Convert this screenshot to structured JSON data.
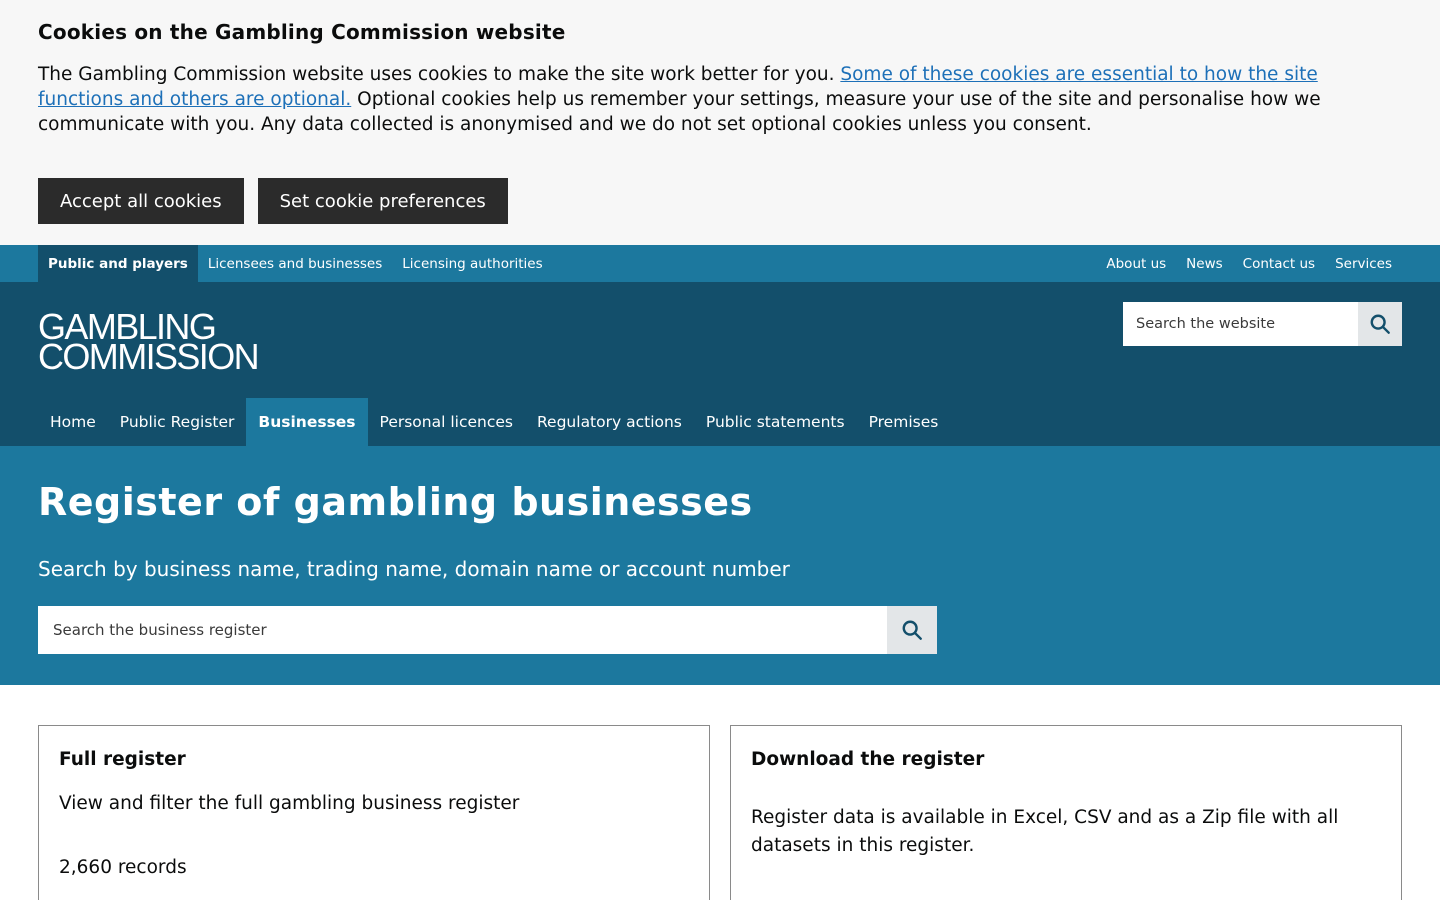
{
  "cookie_banner": {
    "title": "Cookies on the Gambling Commission website",
    "text_before": "The Gambling Commission website uses cookies to make the site work better for you. ",
    "link_text": "Some of these cookies are essential to how the site functions and others are optional.",
    "text_after": " Optional cookies help us remember your settings, measure your use of the site and personalise how we communicate with you. Any data collected is anonymised and we do not set optional cookies unless you consent.",
    "accept_label": "Accept all cookies",
    "preferences_label": "Set cookie preferences"
  },
  "top_nav": {
    "left": [
      "Public and players",
      "Licensees and businesses",
      "Licensing authorities"
    ],
    "right": [
      "About us",
      "News",
      "Contact us",
      "Services"
    ]
  },
  "header": {
    "logo_line1": "GAMBLING",
    "logo_line2": "COMMISSION",
    "search_placeholder": "Search the website"
  },
  "main_nav": [
    "Home",
    "Public Register",
    "Businesses",
    "Personal licences",
    "Regulatory actions",
    "Public statements",
    "Premises"
  ],
  "hero": {
    "title": "Register of gambling businesses",
    "subtitle": "Search by business name, trading name, domain name or account number",
    "search_placeholder": "Search the business register"
  },
  "cards": {
    "full_register": {
      "title": "Full register",
      "description": "View and filter the full gambling business register",
      "count": "2,660 records"
    },
    "download": {
      "title": "Download the register",
      "description": "Register data is available in Excel, CSV and as a Zip file with all datasets in this register."
    }
  },
  "colors": {
    "top_nav_bg": "#1c789e",
    "header_bg": "#134f6b",
    "hero_bg": "#1c789e",
    "link": "#1d70b8"
  }
}
